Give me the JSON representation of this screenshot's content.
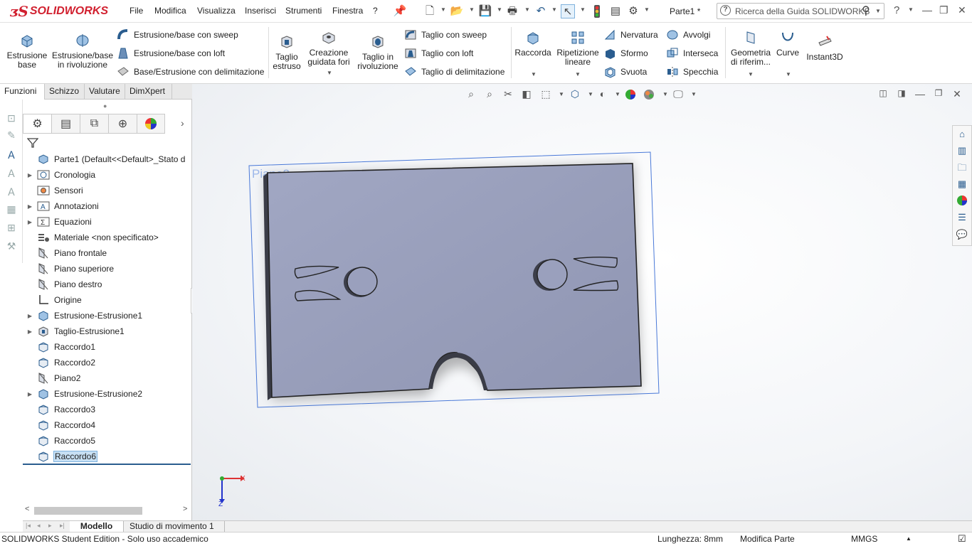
{
  "app": {
    "brand_ds": "3S",
    "brand_name": "SOLIDWORKS"
  },
  "menu": [
    "File",
    "Modifica",
    "Visualizza",
    "Inserisci",
    "Strumenti",
    "Finestra",
    "?"
  ],
  "doc_title": "Parte1 *",
  "search": {
    "placeholder": "Ricerca della Guida SOLIDWORKS",
    "help_label": "?"
  },
  "ribbon": {
    "estrusione_base": [
      "Estrusione",
      "base"
    ],
    "estrusione_rivoluzione": [
      "Estrusione/base",
      "in rivoluzione"
    ],
    "estrusione_sweep": "Estrusione/base con sweep",
    "estrusione_loft": "Estrusione/base con loft",
    "base_delimitazione": "Base/Estrusione con delimitazione",
    "taglio_estruso": [
      "Taglio",
      "estruso"
    ],
    "creazione_fori": [
      "Creazione",
      "guidata fori"
    ],
    "taglio_rivoluzione": [
      "Taglio in",
      "rivoluzione"
    ],
    "taglio_sweep": "Taglio con sweep",
    "taglio_loft": "Taglio con loft",
    "taglio_delimitazione": "Taglio di delimitazione",
    "raccorda": "Raccorda",
    "ripetizione": [
      "Ripetizione",
      "lineare"
    ],
    "nervatura": "Nervatura",
    "sformo": "Sformo",
    "svuota": "Svuota",
    "avvolgi": "Avvolgi",
    "interseca": "Interseca",
    "specchia": "Specchia",
    "geometria": [
      "Geometria",
      "di riferim..."
    ],
    "curve": "Curve",
    "instant3d": "Instant3D"
  },
  "command_tabs": [
    "Funzioni",
    "Schizzo",
    "Valutare",
    "DimXpert"
  ],
  "tree": {
    "root": "Parte1  (Default<<Default>_Stato d",
    "items": [
      {
        "label": "Cronologia",
        "exp": true,
        "icon": "history-folder-icon"
      },
      {
        "label": "Sensori",
        "exp": false,
        "icon": "sensor-icon"
      },
      {
        "label": "Annotazioni",
        "exp": true,
        "icon": "annotations-icon"
      },
      {
        "label": "Equazioni",
        "exp": true,
        "icon": "equations-icon"
      },
      {
        "label": "Materiale <non specificato>",
        "exp": false,
        "icon": "material-icon"
      },
      {
        "label": "Piano frontale",
        "exp": false,
        "icon": "plane-icon"
      },
      {
        "label": "Piano superiore",
        "exp": false,
        "icon": "plane-icon"
      },
      {
        "label": "Piano destro",
        "exp": false,
        "icon": "plane-icon"
      },
      {
        "label": "Origine",
        "exp": false,
        "icon": "origin-icon"
      },
      {
        "label": "Estrusione-Estrusione1",
        "exp": true,
        "icon": "extrude-icon"
      },
      {
        "label": "Taglio-Estrusione1",
        "exp": true,
        "icon": "cut-extrude-icon"
      },
      {
        "label": "Raccordo1",
        "exp": false,
        "icon": "fillet-icon"
      },
      {
        "label": "Raccordo2",
        "exp": false,
        "icon": "fillet-icon"
      },
      {
        "label": "Piano2",
        "exp": false,
        "icon": "plane-icon"
      },
      {
        "label": "Estrusione-Estrusione2",
        "exp": true,
        "icon": "extrude-icon"
      },
      {
        "label": "Raccordo3",
        "exp": false,
        "icon": "fillet-icon"
      },
      {
        "label": "Raccordo4",
        "exp": false,
        "icon": "fillet-icon"
      },
      {
        "label": "Raccordo5",
        "exp": false,
        "icon": "fillet-icon"
      },
      {
        "label": "Raccordo6",
        "exp": false,
        "icon": "fillet-icon",
        "selected": true
      }
    ]
  },
  "viewport": {
    "plane_label": "Piano2",
    "axis_x": "X",
    "axis_z": "Z"
  },
  "bottom_tabs": [
    "Modello",
    "Studio di movimento 1"
  ],
  "status": {
    "edition": "SOLIDWORKS Student Edition - Solo uso accademico",
    "length": "Lunghezza: 8mm",
    "mode": "Modifica Parte",
    "units": "MMGS"
  },
  "colors": {
    "brand": "#d1202f",
    "part_face": "#9aa0bd",
    "plane": "#4a79d8",
    "selection": "#c7e0f4"
  }
}
